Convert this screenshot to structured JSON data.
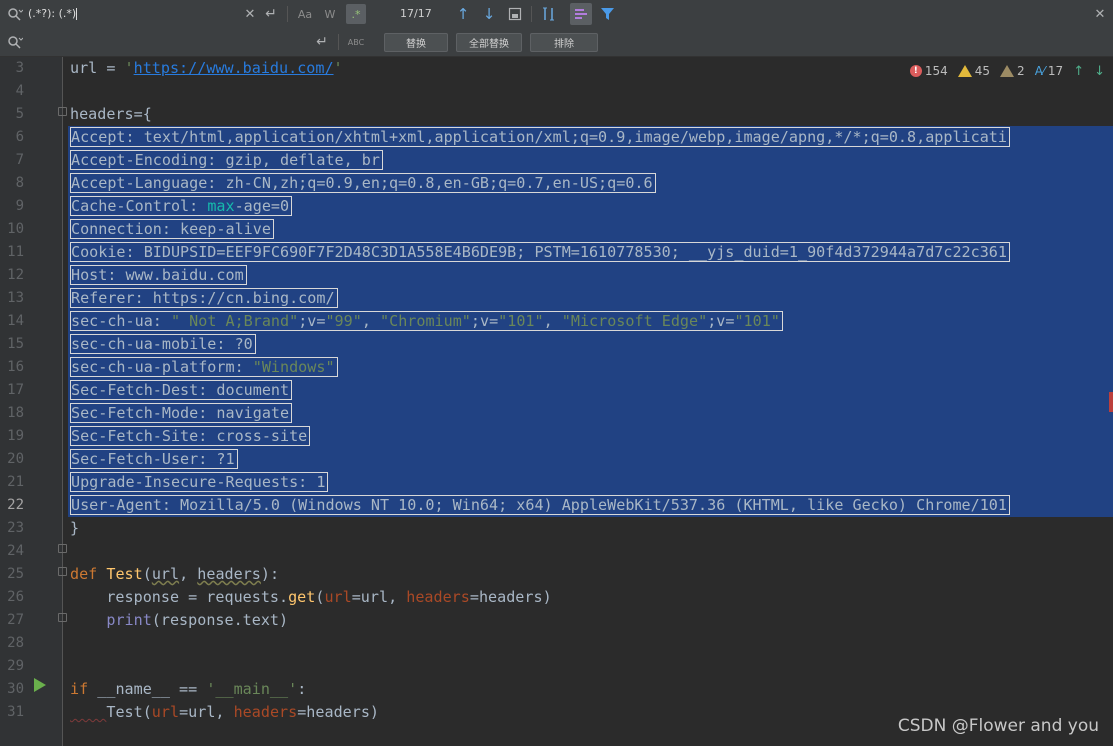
{
  "find": {
    "query": "(.*?): (.*)",
    "case_label": "Aa",
    "word_label": "W",
    "regex_label": ".*",
    "matches": "17/17",
    "replace_label": "替换",
    "replace_all_label": "全部替换",
    "exclude_label": "排除",
    "abc_label": "ABC"
  },
  "inspection": {
    "errors": "154",
    "warnings": "45",
    "weak_warnings": "2",
    "typos": "17"
  },
  "gutter": {
    "lines": [
      "3",
      "4",
      "5",
      "6",
      "7",
      "8",
      "9",
      "10",
      "11",
      "12",
      "13",
      "14",
      "15",
      "16",
      "17",
      "18",
      "19",
      "20",
      "21",
      "22",
      "23",
      "24",
      "25",
      "26",
      "27",
      "28",
      "29",
      "30",
      "31"
    ]
  },
  "code": {
    "l3_var": "url = ",
    "l3_q": "'",
    "l3_url": "https://www.baidu.com/",
    "l5": "headers={",
    "l6": "Accept: text/html,application/xhtml+xml,application/xml;q=0.9,image/webp,image/apng,*/*;q=0.8,applicati",
    "l7": "Accept-Encoding: gzip, deflate, br",
    "l8": "Accept-Language: zh-CN,zh;q=0.9,en;q=0.8,en-GB;q=0.7,en-US;q=0.6",
    "l9a": "Cache-Control: ",
    "l9b": "max",
    "l9c": "-age=0",
    "l10": "Connection: keep-alive",
    "l11": "Cookie: BIDUPSID=EEF9FC690F7F2D48C3D1A558E4B6DE9B; PSTM=1610778530; __yjs_duid=1_90f4d372944a7d7c22c361",
    "l12": "Host: www.baidu.com",
    "l13": "Referer: https://cn.bing.com/",
    "l14a": "sec-ch-ua: ",
    "l14b": "\" Not A;Brand\"",
    "l14c": ";v=",
    "l14d": "\"99\"",
    "l14e": ", ",
    "l14f": "\"Chromium\"",
    "l14g": ";v=",
    "l14h": "\"101\"",
    "l14i": ", ",
    "l14j": "\"Microsoft Edge\"",
    "l14k": ";v=",
    "l14l": "\"101\"",
    "l15": "sec-ch-ua-mobile: ?0",
    "l16a": "sec-ch-ua-platform: ",
    "l16b": "\"Windows\"",
    "l17": "Sec-Fetch-Dest: document",
    "l18": "Sec-Fetch-Mode: navigate",
    "l19": "Sec-Fetch-Site: cross-site",
    "l20": "Sec-Fetch-User: ?1",
    "l21": "Upgrade-Insecure-Requests: 1",
    "l22": "User-Agent: Mozilla/5.0 (Windows NT 10.0; Win64; x64) AppleWebKit/537.36 (KHTML, like Gecko) Chrome/101",
    "l23": "}",
    "l25_def": "def ",
    "l25_fn": "Test",
    "l25_open": "(",
    "l25_p1": "url",
    "l25_comma": ", ",
    "l25_p2": "headers",
    "l25_close": "):",
    "l26_a": "    response = requests.",
    "l26_get": "get",
    "l26_b": "(",
    "l26_kw1": "url",
    "l26_c": "=url, ",
    "l26_kw2": "headers",
    "l26_d": "=headers)",
    "l27_indent": "    ",
    "l27_print": "print",
    "l27_rest": "(response.text)",
    "l30_if": "if ",
    "l30_name": "__name__ == ",
    "l30_str": "'__main__'",
    "l30_colon": ":",
    "l31_indent": "    ",
    "l31_fn": "Test(",
    "l31_kw1": "url",
    "l31_a": "=url, ",
    "l31_kw2": "headers",
    "l31_b": "=headers)"
  },
  "watermark": "CSDN @Flower and you",
  "colors": {
    "selection": "#214283",
    "keyword": "#cc7832",
    "string": "#6a8759",
    "function": "#ffc66d"
  }
}
